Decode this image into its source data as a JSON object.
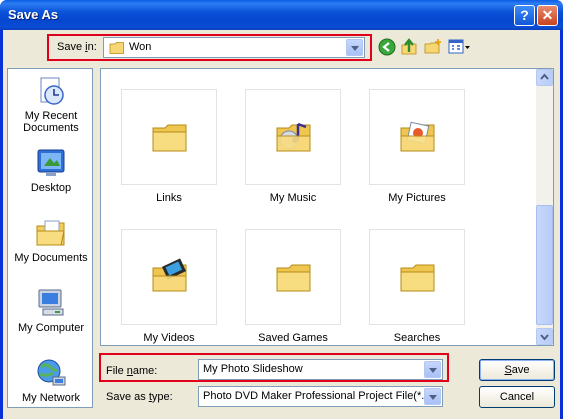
{
  "window": {
    "title": "Save As"
  },
  "titlebar_buttons": {
    "help": "?",
    "close": "✕"
  },
  "save_in": {
    "label_pre": "Save ",
    "label_key": "i",
    "label_post": "n:",
    "value": "Won"
  },
  "toolbar": {
    "icons": [
      "back-icon",
      "up-folder-icon",
      "new-folder-icon",
      "view-menu-icon"
    ]
  },
  "places": [
    {
      "label1": "My Recent",
      "label2": "Documents",
      "icon": "recent-documents-icon"
    },
    {
      "label1": "Desktop",
      "label2": "",
      "icon": "desktop-icon"
    },
    {
      "label1": "My Documents",
      "label2": "",
      "icon": "my-documents-icon"
    },
    {
      "label1": "My Computer",
      "label2": "",
      "icon": "my-computer-icon"
    },
    {
      "label1": "My Network",
      "label2": "",
      "icon": "my-network-icon"
    }
  ],
  "files": [
    {
      "name": "Links",
      "icon": "folder-icon"
    },
    {
      "name": "My Music",
      "icon": "music-folder-icon"
    },
    {
      "name": "My Pictures",
      "icon": "pictures-folder-icon"
    },
    {
      "name": "My Videos",
      "icon": "videos-folder-icon"
    },
    {
      "name": "Saved Games",
      "icon": "folder-icon"
    },
    {
      "name": "Searches",
      "icon": "folder-icon"
    }
  ],
  "file_name": {
    "label_pre": "File ",
    "label_key": "n",
    "label_post": "ame:",
    "value": "My Photo Slideshow"
  },
  "save_as_type": {
    "label_pre": "Save as ",
    "label_key": "t",
    "label_post": "ype:",
    "value": "Photo DVD Maker Professional Project File(*.pc"
  },
  "buttons": {
    "save_key": "S",
    "save_rest": "ave",
    "cancel": "Cancel"
  },
  "colors": {
    "highlight_border": "#e0001b",
    "title_blue": "#0a53d9",
    "dialog_bg": "#ece9d8"
  }
}
